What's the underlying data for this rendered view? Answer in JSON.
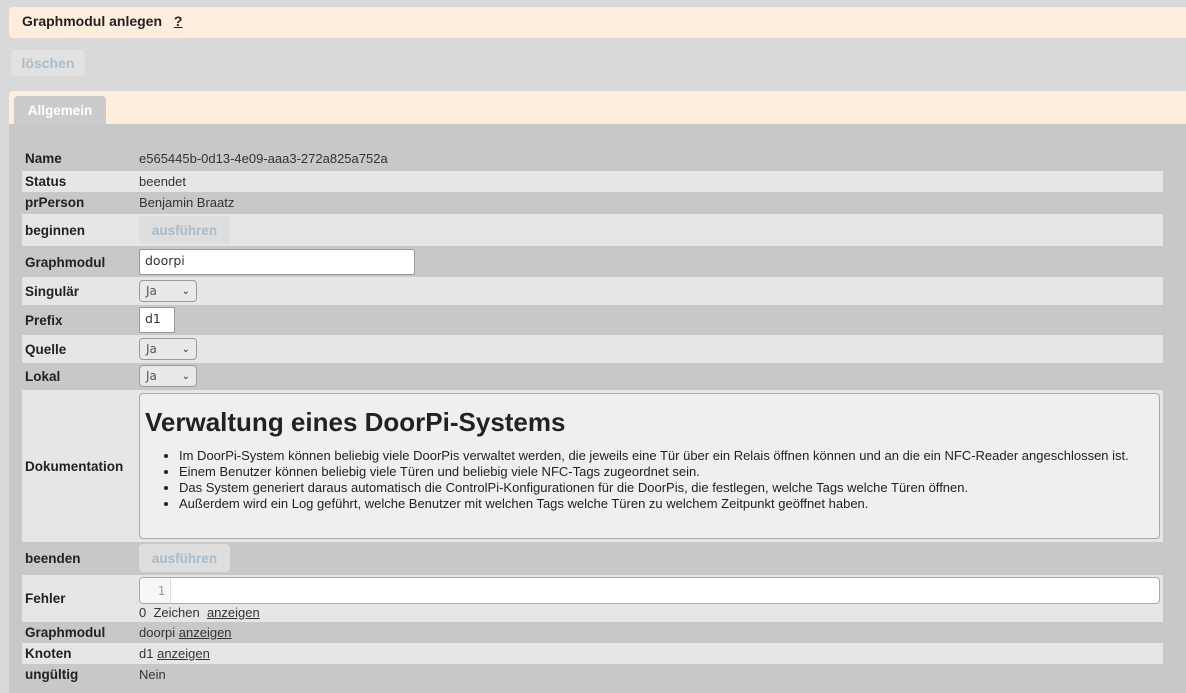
{
  "header": {
    "title": "Graphmodul anlegen",
    "help": "?"
  },
  "toolbar": {
    "delete_label": "löschen"
  },
  "tabs": [
    {
      "label": "Allgemein"
    }
  ],
  "fields": {
    "name": {
      "label": "Name",
      "value": "e565445b-0d13-4e09-aaa3-272a825a752a"
    },
    "status": {
      "label": "Status",
      "value": "beendet"
    },
    "person": {
      "label": "prPerson",
      "value": "Benjamin Braatz"
    },
    "begin": {
      "label": "beginnen",
      "button": "ausführen"
    },
    "graphmodul_input": {
      "label": "Graphmodul",
      "value": "doorpi"
    },
    "singular": {
      "label": "Singulär",
      "value": "Ja"
    },
    "prefix": {
      "label": "Prefix",
      "value": "d1"
    },
    "source": {
      "label": "Quelle",
      "value": "Ja"
    },
    "local": {
      "label": "Lokal",
      "value": "Ja"
    },
    "documentation": {
      "label": "Dokumentation",
      "heading": "Verwaltung eines DoorPi-Systems",
      "items": [
        "Im DoorPi-System können beliebig viele DoorPis verwaltet werden, die jeweils eine Tür über ein Relais öffnen können und an die ein NFC-Reader angeschlossen ist.",
        "Einem Benutzer können beliebig viele Türen und beliebig viele NFC-Tags zugeordnet sein.",
        "Das System generiert daraus automatisch die ControlPi-Konfigurationen für die DoorPis, die festlegen, welche Tags welche Türen öffnen.",
        "Außerdem wird ein Log geführt, welche Benutzer mit welchen Tags welche Türen zu welchem Zeitpunkt geöffnet haben."
      ]
    },
    "end": {
      "label": "beenden",
      "button": "ausführen"
    },
    "error": {
      "label": "Fehler",
      "line_number": "1",
      "char_count": "0",
      "char_label": "Zeichen",
      "show_link": "anzeigen"
    },
    "graphmodul_ref": {
      "label": "Graphmodul",
      "value": "doorpi",
      "link": "anzeigen"
    },
    "node": {
      "label": "Knoten",
      "value": "d1",
      "link": "anzeigen"
    },
    "invalid": {
      "label": "ungültig",
      "value": "Nein"
    }
  }
}
